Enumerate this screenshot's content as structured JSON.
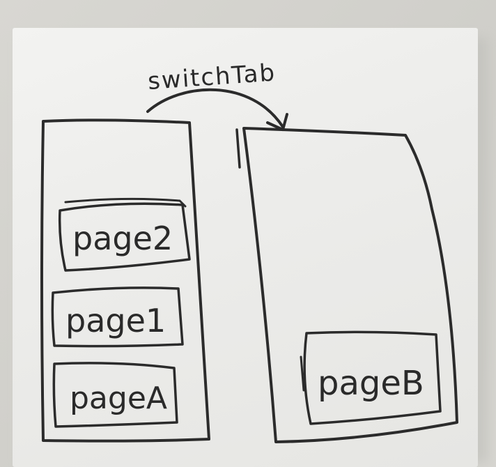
{
  "diagram": {
    "arrow_label": "switchTab",
    "left_stack": {
      "pages": [
        {
          "label": "page2"
        },
        {
          "label": "page1"
        },
        {
          "label": "pageA"
        }
      ]
    },
    "right_stack": {
      "pages": [
        {
          "label": "pageB"
        }
      ]
    }
  }
}
